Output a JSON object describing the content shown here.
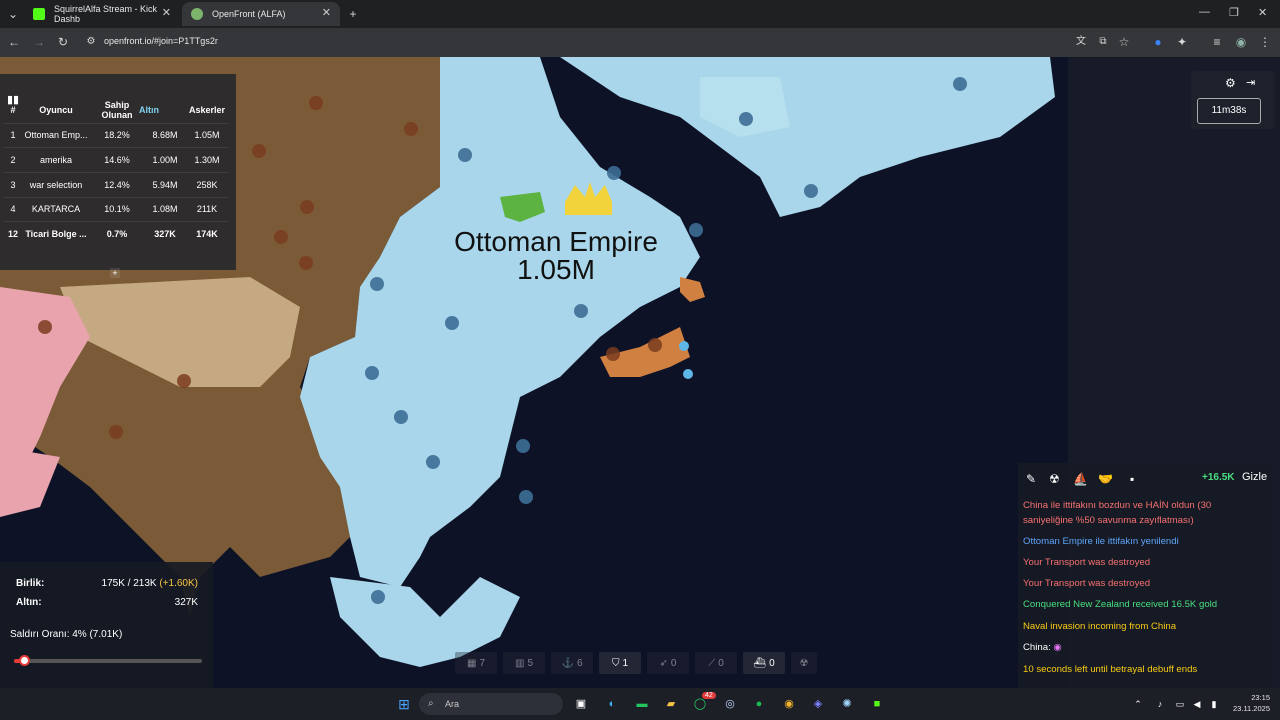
{
  "browser": {
    "tabs": [
      {
        "title": "SquirrelAlfa Stream - Kick Dashb"
      },
      {
        "title": "OpenFront (ALFA)"
      }
    ],
    "url": "openfront.io/#join=P1TTgs2r",
    "new_tab_icon": "plus-icon"
  },
  "map": {
    "leader_name": "Ottoman Empire",
    "leader_troops": "1.05M"
  },
  "leaderboard": {
    "headers": [
      "#",
      "Oyuncu",
      "Sahip Olunan",
      "Altın",
      "Askerler"
    ],
    "rows": [
      {
        "rank": "1",
        "name": "Ottoman Emp...",
        "owned": "18.2%",
        "gold": "8.68M",
        "troops": "1.05M"
      },
      {
        "rank": "2",
        "name": "amerika",
        "owned": "14.6%",
        "gold": "1.00M",
        "troops": "1.30M"
      },
      {
        "rank": "3",
        "name": "war selection",
        "owned": "12.4%",
        "gold": "5.94M",
        "troops": "258K"
      },
      {
        "rank": "4",
        "name": "KARTARCA",
        "owned": "10.1%",
        "gold": "1.08M",
        "troops": "211K"
      },
      {
        "rank": "12",
        "name": "Ticari Bolge ...",
        "owned": "0.7%",
        "gold": "327K",
        "troops": "174K"
      }
    ],
    "expand_label": "+"
  },
  "timer": "11m38s",
  "stats": {
    "units_label": "Birlik:",
    "units_value": "175K / 213K",
    "units_gain": "(+1.60K)",
    "gold_label": "Altın:",
    "gold_value": "327K",
    "attack_ratio_label": "Saldırı Oranı: 4% (7.01K)",
    "attack_ratio": 0.04
  },
  "buildbar": [
    {
      "icon": "city-icon",
      "count": "7",
      "dim": true
    },
    {
      "icon": "factory-icon",
      "count": "5",
      "dim": true
    },
    {
      "icon": "port-icon",
      "count": "6",
      "dim": true
    },
    {
      "icon": "defense-post-icon",
      "count": "1",
      "dim": false
    },
    {
      "icon": "missile-silo-icon",
      "count": "0",
      "dim": true
    },
    {
      "icon": "sam-launcher-icon",
      "count": "0",
      "dim": true
    },
    {
      "icon": "warship-icon",
      "count": "0",
      "dim": false
    },
    {
      "icon": "nuke-icon",
      "count": "",
      "dim": true
    }
  ],
  "events": {
    "gold_income": "+16.5K",
    "hide_label": "Gizle",
    "items": [
      {
        "text": "China ile ittifakını bozdun ve HAİN oldun (30 saniyeliğine %50 savunma zayıflatması)",
        "color": "#f87171"
      },
      {
        "text": "Ottoman Empire ile ittifakın yenilendi",
        "color": "#60a5fa"
      },
      {
        "text": "Your Transport was destroyed",
        "color": "#f87171"
      },
      {
        "text": "Your Transport was destroyed",
        "color": "#f87171"
      },
      {
        "text": "Conquered New Zealand received 16.5K gold",
        "color": "#4ade80"
      },
      {
        "text": "Naval invasion incoming from China",
        "color": "#facc15"
      },
      {
        "text": "China:",
        "color": "#ffffff"
      },
      {
        "text": "10 seconds left until betrayal debuff ends",
        "color": "#facc15"
      }
    ]
  },
  "taskbar": {
    "search_placeholder": "Ara",
    "notification_count": "42",
    "time": "23:15",
    "date": "23.11.2025"
  }
}
